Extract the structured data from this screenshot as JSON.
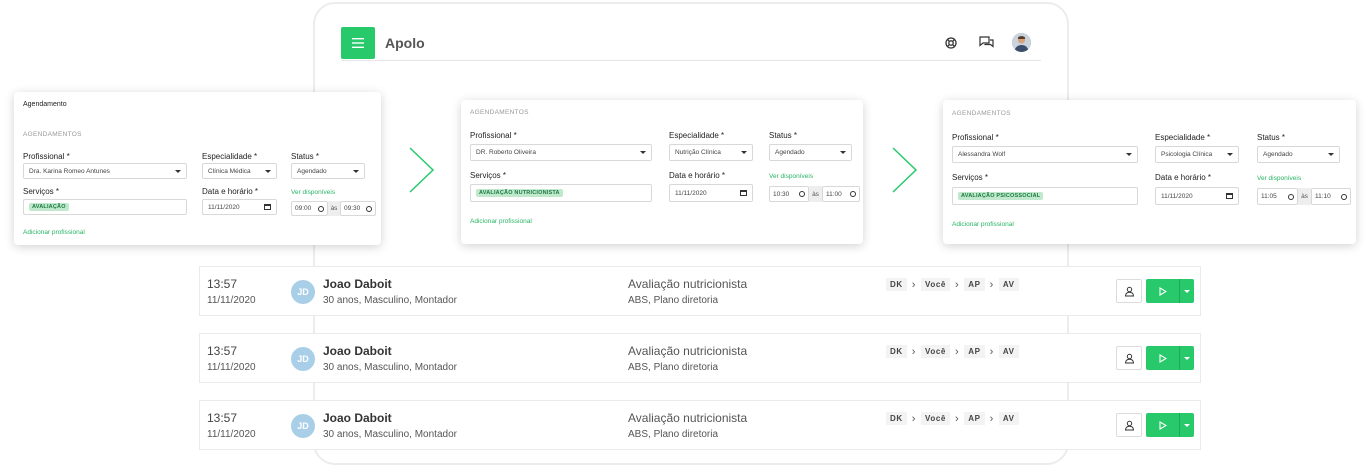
{
  "header": {
    "app_title": "Apolo",
    "icons": [
      "menu-icon",
      "support-icon",
      "chat-icon",
      "avatar"
    ]
  },
  "colors": {
    "accent": "#27c96b",
    "chip_bg": "#bfe8cd",
    "chip_text": "#1c7a40"
  },
  "cards": [
    {
      "top_title": "Agendamento",
      "section": "AGENDAMENTOS",
      "profissional_label": "Profissional *",
      "profissional_value": "Dra. Karina Romeo Antunes",
      "especialidade_label": "Especialidade *",
      "especialidade_value": "Clínica Médica",
      "status_label": "Status *",
      "status_value": "Agendado",
      "servicos_label": "Serviços *",
      "servico_chip": "AVALIAÇÃO",
      "data_label": "Data e horário *",
      "data_value": "11/11/2020",
      "ver_link": "Ver disponíveis",
      "time_start": "09:00",
      "ate": "às",
      "time_end": "09:30",
      "add_link": "Adicionar profissional"
    },
    {
      "top_title": "",
      "section": "AGENDAMENTOS",
      "profissional_label": "Profissional *",
      "profissional_value": "DR. Roberto Oliveira",
      "especialidade_label": "Especialidade *",
      "especialidade_value": "Nutrição Clínica",
      "status_label": "Status *",
      "status_value": "Agendado",
      "servicos_label": "Serviços *",
      "servico_chip": "AVALIAÇÃO NUTRICIONISTA",
      "data_label": "Data e horário *",
      "data_value": "11/11/2020",
      "ver_link": "Ver disponíveis",
      "time_start": "10:30",
      "ate": "às",
      "time_end": "11:00",
      "add_link": "Adicionar profissional"
    },
    {
      "top_title": "",
      "section": "AGENDAMENTOS",
      "profissional_label": "Profissional *",
      "profissional_value": "Alessandra Wolf",
      "especialidade_label": "Especialidade *",
      "especialidade_value": "Psicologia Clínica",
      "status_label": "Status *",
      "status_value": "Agendado",
      "servicos_label": "Serviços *",
      "servico_chip": "AVALIAÇÃO PSICOSSOCIAL",
      "data_label": "Data e horário *",
      "data_value": "11/11/2020",
      "ver_link": "Ver disponíveis",
      "time_start": "11:05",
      "ate": "às",
      "time_end": "11:10",
      "add_link": "Adicionar profissional"
    }
  ],
  "rows": [
    {
      "time": "13:57",
      "date": "11/11/2020",
      "initials": "JD",
      "name": "Joao Daboit",
      "info": "30 anos, Masculino, Montador",
      "service": "Avaliação nutricionista",
      "plan": "ABS, Plano diretoria",
      "flow": [
        "DK",
        "Você",
        "AP",
        "AV"
      ]
    },
    {
      "time": "13:57",
      "date": "11/11/2020",
      "initials": "JD",
      "name": "Joao Daboit",
      "info": "30 anos, Masculino, Montador",
      "service": "Avaliação nutricionista",
      "plan": "ABS, Plano diretoria",
      "flow": [
        "DK",
        "Você",
        "AP",
        "AV"
      ]
    },
    {
      "time": "13:57",
      "date": "11/11/2020",
      "initials": "JD",
      "name": "Joao Daboit",
      "info": "30 anos, Masculino, Montador",
      "service": "Avaliação nutricionista",
      "plan": "ABS, Plano diretoria",
      "flow": [
        "DK",
        "Você",
        "AP",
        "AV"
      ]
    }
  ]
}
